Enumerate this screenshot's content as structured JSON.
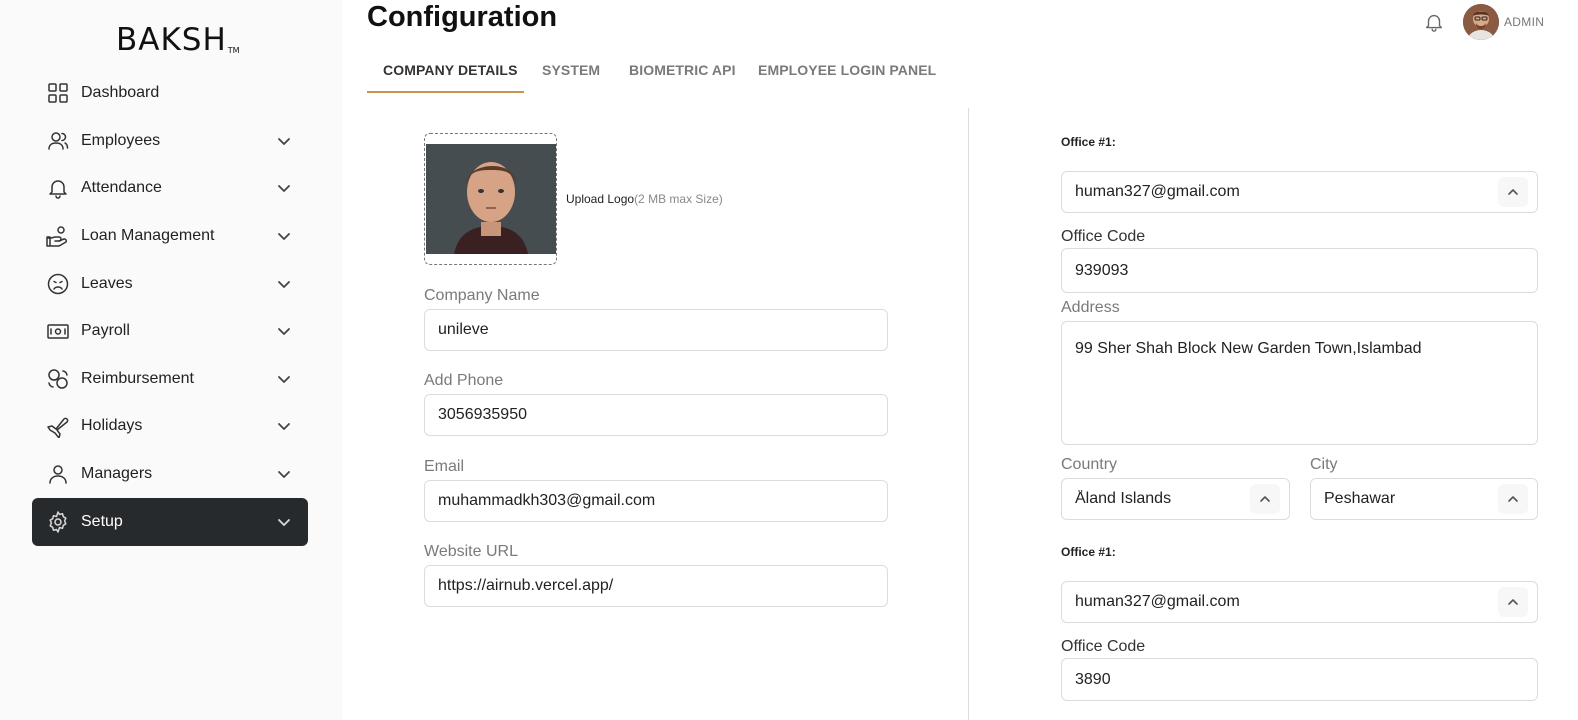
{
  "brand": {
    "name": "BAKSH",
    "tm": "TM"
  },
  "sidebar": {
    "items": [
      {
        "label": "Dashboard",
        "icon": "grid-icon",
        "has_chevron": false
      },
      {
        "label": "Employees",
        "icon": "users-icon",
        "has_chevron": true
      },
      {
        "label": "Attendance",
        "icon": "bell-icon",
        "has_chevron": true
      },
      {
        "label": "Loan Management",
        "icon": "hand-coins-icon",
        "has_chevron": true
      },
      {
        "label": "Leaves",
        "icon": "sad-face-icon",
        "has_chevron": true
      },
      {
        "label": "Payroll",
        "icon": "banknote-icon",
        "has_chevron": true
      },
      {
        "label": "Reimbursement",
        "icon": "refresh-coins-icon",
        "has_chevron": true
      },
      {
        "label": "Holidays",
        "icon": "plane-icon",
        "has_chevron": true
      },
      {
        "label": "Managers",
        "icon": "user-icon",
        "has_chevron": true
      },
      {
        "label": "Setup",
        "icon": "gear-icon",
        "has_chevron": true,
        "active": true
      }
    ]
  },
  "header": {
    "title": "Configuration",
    "user_label": "ADMIN"
  },
  "tabs": [
    {
      "label": "COMPANY DETAILS",
      "active": true
    },
    {
      "label": "SYSTEM"
    },
    {
      "label": "BIOMETRIC API"
    },
    {
      "label": "EMPLOYEE LOGIN PANEL"
    }
  ],
  "company": {
    "upload_label": "Upload Logo",
    "upload_hint": "(2 MB max Size)",
    "name_label": "Company Name",
    "name_value": "unileve",
    "phone_label": "Add Phone",
    "phone_value": "3056935950",
    "email_label": "Email",
    "email_value": "muhammadkh303@gmail.com",
    "website_label": "Website URL",
    "website_value": "https://airnub.vercel.app/"
  },
  "offices": [
    {
      "heading": "Office #1:",
      "email": "human327@gmail.com",
      "code_label": "Office Code",
      "code_value": "939093",
      "address_label": "Address",
      "address_value": "99 Sher  Shah Block New Garden Town,Islambad",
      "country_label": "Country",
      "country_value": "Åland Islands",
      "city_label": "City",
      "city_value": "Peshawar"
    },
    {
      "heading": "Office #1:",
      "email": "human327@gmail.com",
      "code_label": "Office Code",
      "code_value": "3890"
    }
  ],
  "colors": {
    "accent": "#c8924f",
    "active_nav": "#272a2d",
    "sidebar_bg": "#fafafa"
  }
}
